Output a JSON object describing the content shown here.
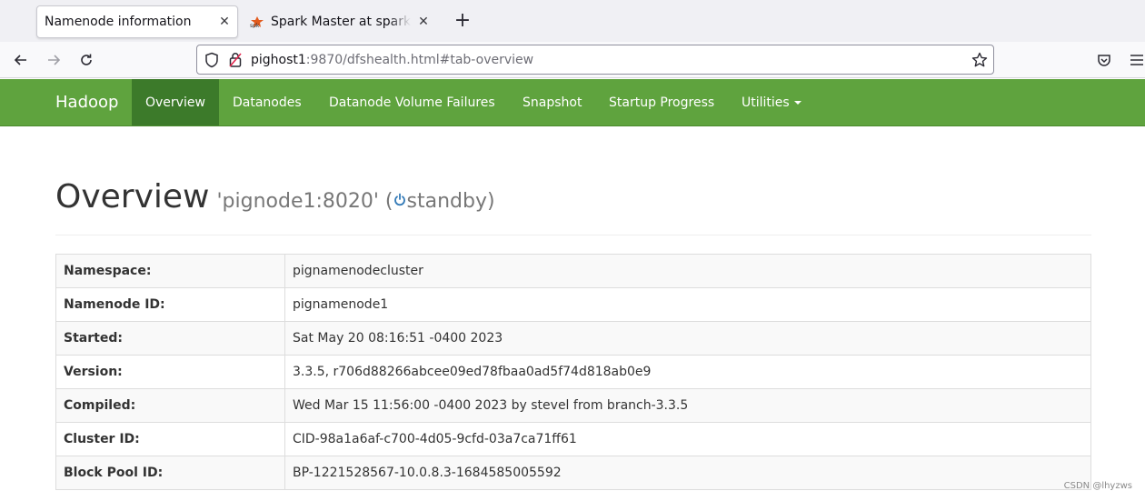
{
  "browser": {
    "tabs": [
      {
        "title": "Namenode information",
        "active": true
      },
      {
        "title": "Spark Master at spark://pi",
        "active": false
      }
    ],
    "url": {
      "host": "pighost1",
      "rest": ":9870/dfshealth.html#tab-overview"
    }
  },
  "hadoop_nav": {
    "brand": "Hadoop",
    "items": [
      {
        "label": "Overview",
        "active": true
      },
      {
        "label": "Datanodes"
      },
      {
        "label": "Datanode Volume Failures"
      },
      {
        "label": "Snapshot"
      },
      {
        "label": "Startup Progress"
      },
      {
        "label": "Utilities",
        "dropdown": true
      }
    ],
    "color": "#5fa33e",
    "active_color": "#3c7a2a"
  },
  "overview": {
    "title": "Overview",
    "host": "'pignode1:8020' (",
    "state": "standby)",
    "rows": [
      {
        "key": "Namespace:",
        "value": "pignamenodecluster"
      },
      {
        "key": "Namenode ID:",
        "value": "pignamenode1"
      },
      {
        "key": "Started:",
        "value": "Sat May 20 08:16:51 -0400 2023"
      },
      {
        "key": "Version:",
        "value": "3.3.5, r706d88266abcee09ed78fbaa0ad5f74d818ab0e9"
      },
      {
        "key": "Compiled:",
        "value": "Wed Mar 15 11:56:00 -0400 2023 by stevel from branch-3.3.5"
      },
      {
        "key": "Cluster ID:",
        "value": "CID-98a1a6af-c700-4d05-9cfd-03a7ca71ff61"
      },
      {
        "key": "Block Pool ID:",
        "value": "BP-1221528567-10.0.8.3-1684585005592"
      }
    ]
  },
  "watermark": "CSDN @lhyzws",
  "icons": [
    "close-icon",
    "spark-favicon",
    "plus-icon",
    "back-arrow-icon",
    "forward-arrow-icon",
    "reload-icon",
    "shield-icon",
    "lock-icon",
    "star-icon",
    "pocket-icon",
    "hamburger-menu-icon",
    "power-icon"
  ]
}
